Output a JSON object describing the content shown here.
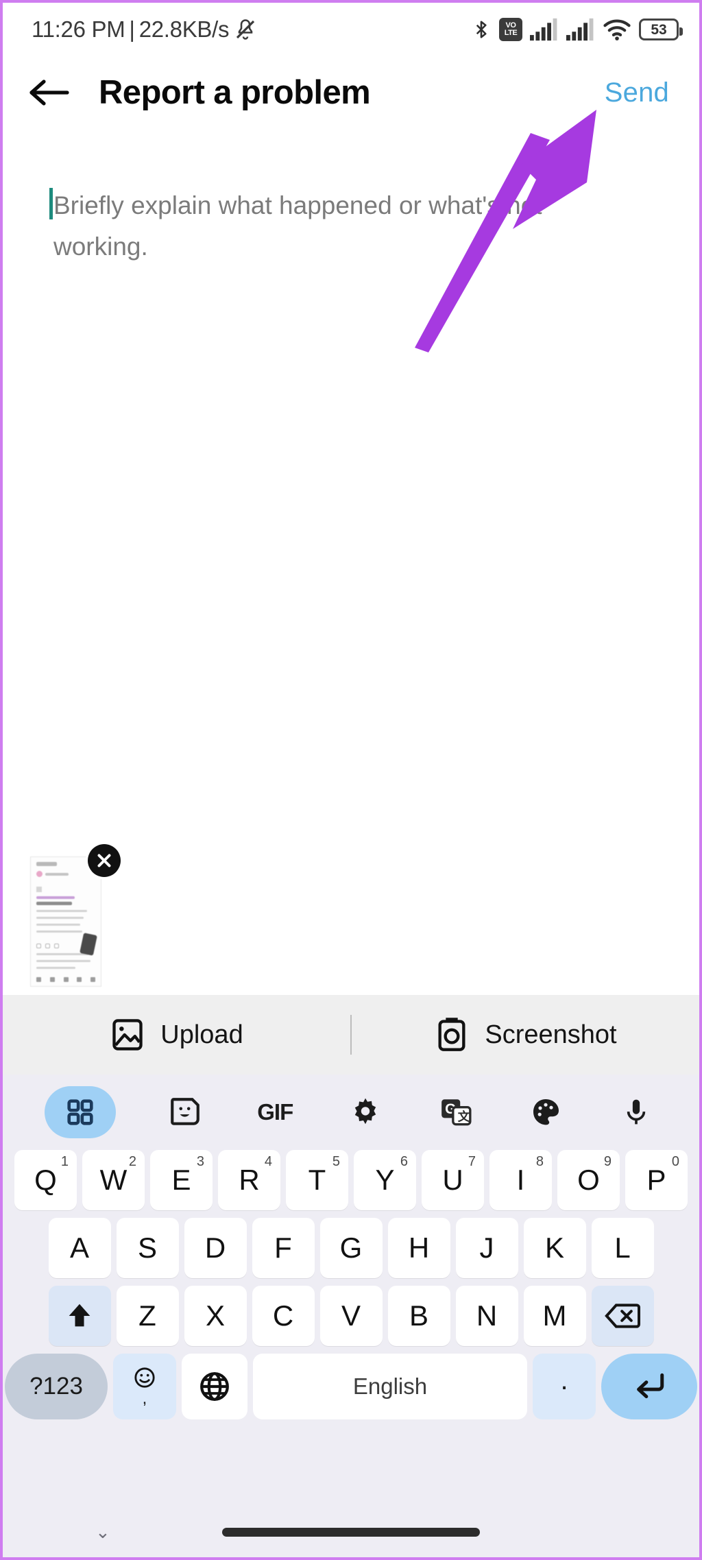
{
  "status_bar": {
    "time": "11:26 PM",
    "separator": "|",
    "network_speed": "22.8KB/s",
    "icons": [
      "mute-icon",
      "bluetooth-icon",
      "volte-icon",
      "signal-sim1-icon",
      "signal-sim2-icon",
      "wifi-icon",
      "battery-icon"
    ],
    "volte_top": "VO",
    "volte_bottom": "LTE",
    "battery_level": "53"
  },
  "header": {
    "back_icon": "back-arrow-icon",
    "title": "Report a problem",
    "send_label": "Send",
    "send_color": "#4ba8dd"
  },
  "compose": {
    "placeholder": "Briefly explain what happened or what's not working.",
    "value": "",
    "caret_color": "#1e8b7e"
  },
  "attachment": {
    "remove_label": "✕",
    "alt": "screenshot-thumbnail"
  },
  "upload_bar": {
    "items": [
      {
        "label": "Upload",
        "icon": "image-icon"
      },
      {
        "label": "Screenshot",
        "icon": "camera-icon"
      }
    ]
  },
  "keyboard": {
    "toolbar": [
      {
        "name": "grid-icon",
        "label": "",
        "active": true
      },
      {
        "name": "sticker-icon",
        "label": "",
        "active": false
      },
      {
        "name": "gif-icon",
        "label": "GIF",
        "active": false
      },
      {
        "name": "gear-icon",
        "label": "",
        "active": false
      },
      {
        "name": "translate-icon",
        "label": "",
        "active": false
      },
      {
        "name": "palette-icon",
        "label": "",
        "active": false
      },
      {
        "name": "microphone-icon",
        "label": "",
        "active": false
      }
    ],
    "row1": [
      {
        "key": "Q",
        "num": "1"
      },
      {
        "key": "W",
        "num": "2"
      },
      {
        "key": "E",
        "num": "3"
      },
      {
        "key": "R",
        "num": "4"
      },
      {
        "key": "T",
        "num": "5"
      },
      {
        "key": "Y",
        "num": "6"
      },
      {
        "key": "U",
        "num": "7"
      },
      {
        "key": "I",
        "num": "8"
      },
      {
        "key": "O",
        "num": "9"
      },
      {
        "key": "P",
        "num": "0"
      }
    ],
    "row2": [
      "A",
      "S",
      "D",
      "F",
      "G",
      "H",
      "J",
      "K",
      "L"
    ],
    "row3": [
      "Z",
      "X",
      "C",
      "V",
      "B",
      "N",
      "M"
    ],
    "shift_icon": "shift-up-arrow-icon",
    "backspace_icon": "backspace-icon",
    "row4": {
      "symbols_label": "?123",
      "emoji_icon": "emoji-icon",
      "comma_label": ",",
      "globe_icon": "globe-icon",
      "space_label": "English",
      "period_label": ".",
      "enter_icon": "enter-icon"
    }
  },
  "nav_bar": {
    "dismiss_icon": "chevron-down-icon",
    "home_indicator": "home-pill"
  },
  "annotation": {
    "arrow_color": "#a63ae0",
    "points_to": "Send"
  }
}
